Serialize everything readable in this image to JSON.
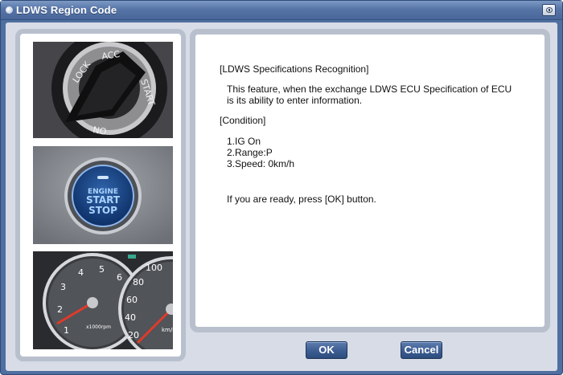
{
  "window": {
    "title": "LDWS Region Code"
  },
  "images": {
    "key": {
      "labels": [
        "LOCK",
        "ACC",
        "START",
        "ON"
      ]
    },
    "button": {
      "labels": [
        "ENGINE",
        "START",
        "STOP"
      ]
    },
    "gauge": {
      "tach_ticks": [
        "1",
        "2",
        "3",
        "4",
        "5",
        "6"
      ],
      "tach_unit": "x1000rpm",
      "speed_ticks": [
        "20",
        "40",
        "60",
        "80",
        "100"
      ],
      "speed_unit": "km/h"
    }
  },
  "content": {
    "heading": "[LDWS Specifications Recognition]",
    "paragraph_line1": "This feature, when the exchange LDWS ECU Specification of ECU",
    "paragraph_line2": "is its ability to enter information.",
    "condition_heading": "[Condition]",
    "conditions": [
      "1.IG On",
      "2.Range:P",
      "3.Speed: 0km/h"
    ],
    "ready_text": "If you are ready, press [OK] button."
  },
  "buttons": {
    "ok": "OK",
    "cancel": "Cancel"
  },
  "colors": {
    "titlebar": "#5674a6",
    "client_bg": "#d7dce6",
    "panel_border": "#b9c0cd",
    "button": "#3c5d92"
  }
}
